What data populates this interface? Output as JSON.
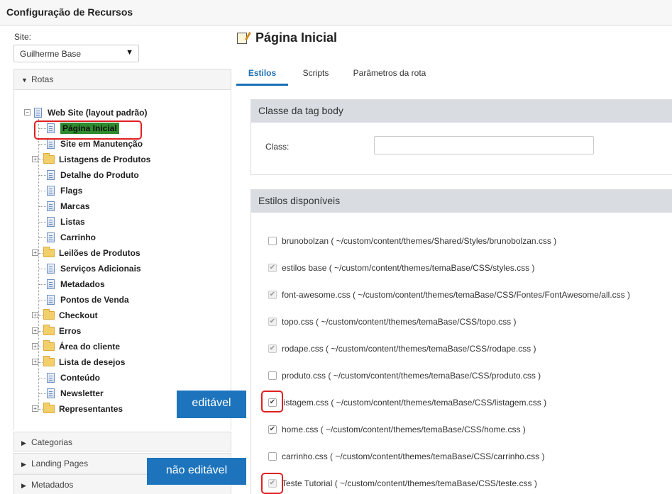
{
  "app": {
    "title": "Configuração de Recursos"
  },
  "site": {
    "label": "Site:",
    "selected": "Guilherme Base"
  },
  "accordions": {
    "rotas": "Rotas",
    "categorias": "Categorias",
    "landing": "Landing Pages",
    "metadados": "Metadados"
  },
  "tree": {
    "root": "Web Site (layout padrão)",
    "items": [
      {
        "label": "Página Inicial",
        "type": "doc",
        "selected": true
      },
      {
        "label": "Site em Manutenção",
        "type": "doc"
      },
      {
        "label": "Listagens de Produtos",
        "type": "folder"
      },
      {
        "label": "Detalhe do Produto",
        "type": "doc"
      },
      {
        "label": "Flags",
        "type": "doc"
      },
      {
        "label": "Marcas",
        "type": "doc"
      },
      {
        "label": "Listas",
        "type": "doc"
      },
      {
        "label": "Carrinho",
        "type": "doc"
      },
      {
        "label": "Leilões de Produtos",
        "type": "folder"
      },
      {
        "label": "Serviços Adicionais",
        "type": "doc"
      },
      {
        "label": "Metadados",
        "type": "doc"
      },
      {
        "label": "Pontos de Venda",
        "type": "doc"
      },
      {
        "label": "Checkout",
        "type": "folder"
      },
      {
        "label": "Erros",
        "type": "folder"
      },
      {
        "label": "Área do cliente",
        "type": "folder"
      },
      {
        "label": "Lista de desejos",
        "type": "folder"
      },
      {
        "label": "Conteúdo",
        "type": "doc"
      },
      {
        "label": "Newsletter",
        "type": "doc"
      },
      {
        "label": "Representantes",
        "type": "folder"
      }
    ]
  },
  "main": {
    "title": "Página Inicial",
    "tabs": [
      "Estilos",
      "Scripts",
      "Parâmetros da rota"
    ],
    "body_class_panel": {
      "title": "Classe da tag body",
      "class_label": "Class:",
      "class_value": ""
    },
    "styles_panel": {
      "title": "Estilos disponíveis",
      "items": [
        {
          "label": "brunobolzan ( ~/custom/content/themes/Shared/Styles/brunobolzan.css )",
          "checked": false,
          "disabled": false
        },
        {
          "label": "estilos base ( ~/custom/content/themes/temaBase/CSS/styles.css )",
          "checked": true,
          "disabled": true
        },
        {
          "label": "font-awesome.css ( ~/custom/content/themes/temaBase/CSS/Fontes/FontAwesome/all.css )",
          "checked": true,
          "disabled": true
        },
        {
          "label": "topo.css ( ~/custom/content/themes/temaBase/CSS/topo.css )",
          "checked": true,
          "disabled": true
        },
        {
          "label": "rodape.css ( ~/custom/content/themes/temaBase/CSS/rodape.css )",
          "checked": true,
          "disabled": true
        },
        {
          "label": "produto.css ( ~/custom/content/themes/temaBase/CSS/produto.css )",
          "checked": false,
          "disabled": false
        },
        {
          "label": "listagem.css ( ~/custom/content/themes/temaBase/CSS/listagem.css )",
          "checked": true,
          "disabled": false
        },
        {
          "label": "home.css ( ~/custom/content/themes/temaBase/CSS/home.css )",
          "checked": true,
          "disabled": false
        },
        {
          "label": "carrinho.css ( ~/custom/content/themes/temaBase/CSS/carrinho.css )",
          "checked": false,
          "disabled": false
        },
        {
          "label": "Teste Tutorial ( ~/custom/content/themes/temaBase/CSS/teste.css )",
          "checked": true,
          "disabled": true
        }
      ]
    }
  },
  "callouts": {
    "editable": "editável",
    "not_editable": "não editável"
  },
  "colors": {
    "accent": "#1a6fb5",
    "callout": "#1d74bd",
    "highlight_box": "#e02020",
    "selected_node": "#2e8b2e"
  }
}
